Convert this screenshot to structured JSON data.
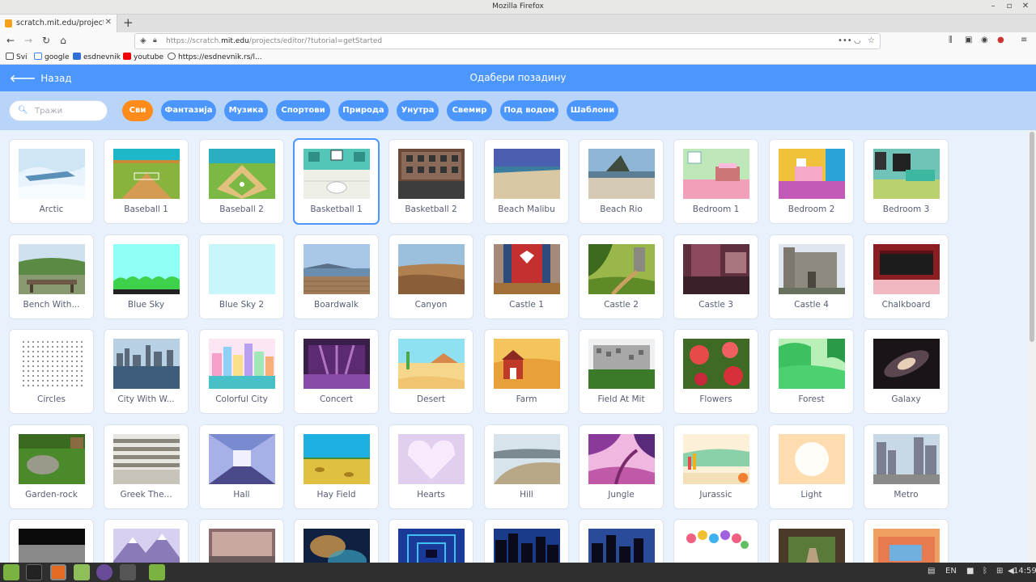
{
  "os": {
    "window_title": "Mozilla Firefox"
  },
  "browser": {
    "tab_title": "scratch.mit.edu/projects/e",
    "url_prefix": "https://scratch.",
    "url_domain": "mit.edu",
    "url_path": "/projects/editor/?tutorial=getStarted",
    "bookmarks": [
      "Svi",
      "google",
      "esdnevnik",
      "youtube",
      "https://esdnevnik.rs/l..."
    ]
  },
  "header": {
    "back_label": "Назад",
    "title": "Одабери позадину"
  },
  "search": {
    "placeholder": "Тражи"
  },
  "filters": [
    {
      "label": "Сви",
      "active": true
    },
    {
      "label": "Фантазија",
      "active": false
    },
    {
      "label": "Музика",
      "active": false
    },
    {
      "label": "Спортови",
      "active": false
    },
    {
      "label": "Природа",
      "active": false
    },
    {
      "label": "Унутра",
      "active": false
    },
    {
      "label": "Свемир",
      "active": false
    },
    {
      "label": "Под водом",
      "active": false
    },
    {
      "label": "Шаблони",
      "active": false
    }
  ],
  "backdrops": [
    {
      "name": "Arctic",
      "art": "arctic"
    },
    {
      "name": "Baseball 1",
      "art": "baseball1"
    },
    {
      "name": "Baseball 2",
      "art": "baseball2"
    },
    {
      "name": "Basketball 1",
      "art": "basketball1",
      "selected": true
    },
    {
      "name": "Basketball 2",
      "art": "basketball2"
    },
    {
      "name": "Beach Malibu",
      "art": "beachmalibu"
    },
    {
      "name": "Beach Rio",
      "art": "beachrio"
    },
    {
      "name": "Bedroom 1",
      "art": "bedroom1"
    },
    {
      "name": "Bedroom 2",
      "art": "bedroom2"
    },
    {
      "name": "Bedroom 3",
      "art": "bedroom3"
    },
    {
      "name": "Bench With...",
      "art": "bench"
    },
    {
      "name": "Blue Sky",
      "art": "bluesky"
    },
    {
      "name": "Blue Sky 2",
      "art": "bluesky2"
    },
    {
      "name": "Boardwalk",
      "art": "boardwalk"
    },
    {
      "name": "Canyon",
      "art": "canyon"
    },
    {
      "name": "Castle 1",
      "art": "castle1"
    },
    {
      "name": "Castle 2",
      "art": "castle2"
    },
    {
      "name": "Castle 3",
      "art": "castle3"
    },
    {
      "name": "Castle 4",
      "art": "castle4"
    },
    {
      "name": "Chalkboard",
      "art": "chalkboard"
    },
    {
      "name": "Circles",
      "art": "circles"
    },
    {
      "name": "City With W...",
      "art": "citywater"
    },
    {
      "name": "Colorful City",
      "art": "colorfulcity"
    },
    {
      "name": "Concert",
      "art": "concert"
    },
    {
      "name": "Desert",
      "art": "desert"
    },
    {
      "name": "Farm",
      "art": "farm"
    },
    {
      "name": "Field At Mit",
      "art": "fieldmit"
    },
    {
      "name": "Flowers",
      "art": "flowers"
    },
    {
      "name": "Forest",
      "art": "forest"
    },
    {
      "name": "Galaxy",
      "art": "galaxy"
    },
    {
      "name": "Garden-rock",
      "art": "gardenrock"
    },
    {
      "name": "Greek The...",
      "art": "greek"
    },
    {
      "name": "Hall",
      "art": "hall"
    },
    {
      "name": "Hay Field",
      "art": "hayfield"
    },
    {
      "name": "Hearts",
      "art": "hearts"
    },
    {
      "name": "Hill",
      "art": "hill"
    },
    {
      "name": "Jungle",
      "art": "jungle"
    },
    {
      "name": "Jurassic",
      "art": "jurassic"
    },
    {
      "name": "Light",
      "art": "light"
    },
    {
      "name": "Metro",
      "art": "metro"
    },
    {
      "name": "",
      "art": "moon"
    },
    {
      "name": "",
      "art": "mountain"
    },
    {
      "name": "",
      "art": "mural"
    },
    {
      "name": "",
      "art": "nebula"
    },
    {
      "name": "",
      "art": "neontunnel"
    },
    {
      "name": "",
      "art": "night1"
    },
    {
      "name": "",
      "art": "night2"
    },
    {
      "name": "",
      "art": "party"
    },
    {
      "name": "",
      "art": "pathway"
    },
    {
      "name": "",
      "art": "playground"
    }
  ],
  "taskbar": {
    "lang": "EN",
    "time": "14:59"
  },
  "colors": {
    "scratch_blue": "#4c97ff",
    "active_orange": "#ff8c1a",
    "filter_bar": "#b9d4f9"
  }
}
